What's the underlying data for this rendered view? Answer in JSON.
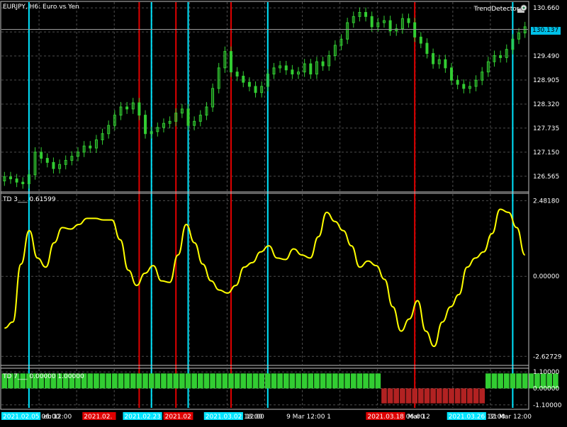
{
  "window": {
    "title": "EURJPY, H6:  Euro vs Yen",
    "indicator_name": "TrendDetector+",
    "current_price": "130.137"
  },
  "colors": {
    "background": "#000000",
    "bull_candle": "#32cd32",
    "signal_up": "#00e5ff",
    "signal_down": "#e00000",
    "osc_line": "#ffff00",
    "hist_up": "#32cd32",
    "hist_down": "#b22222",
    "grid": "#4d4d4d"
  },
  "panes": {
    "td3_label": "TD 3___  0.61599",
    "td7_label": "TD 7___  0.00000 1.00000"
  },
  "chart_data": [
    {
      "type": "candlestick",
      "name": "EURJPY H6",
      "y_ticks": [
        "130.660",
        "130.075",
        "129.490",
        "128.905",
        "128.320",
        "127.735",
        "127.150",
        "126.565"
      ],
      "ylim": [
        126.2,
        130.8
      ],
      "close": [
        126.55,
        126.5,
        126.42,
        126.38,
        126.6,
        127.15,
        127.0,
        126.9,
        126.75,
        126.85,
        126.95,
        127.05,
        127.15,
        127.3,
        127.25,
        127.45,
        127.6,
        127.8,
        128.05,
        128.25,
        128.2,
        128.35,
        128.05,
        127.6,
        127.65,
        127.75,
        127.85,
        127.9,
        128.1,
        128.2,
        127.8,
        127.9,
        128.05,
        128.25,
        128.7,
        129.2,
        129.6,
        129.1,
        129.0,
        128.85,
        128.75,
        128.6,
        128.75,
        129.05,
        129.2,
        129.25,
        129.15,
        129.05,
        129.1,
        129.3,
        129.05,
        129.35,
        129.25,
        129.5,
        129.75,
        129.9,
        130.3,
        130.45,
        130.55,
        130.45,
        130.2,
        130.3,
        130.35,
        130.1,
        130.15,
        130.4,
        130.3,
        129.95,
        129.8,
        129.55,
        129.3,
        129.4,
        129.2,
        128.9,
        128.8,
        128.7,
        128.75,
        128.9,
        129.1,
        129.35,
        129.5,
        129.45,
        129.65,
        129.9,
        130.05,
        130.2
      ]
    },
    {
      "type": "line",
      "name": "TD 3",
      "y_ticks": [
        "2.48180",
        "0.00000",
        "-2.62729"
      ],
      "ylim": [
        -2.9,
        2.7
      ],
      "values": [
        -1.7,
        -1.5,
        0.4,
        1.5,
        0.6,
        0.3,
        1.1,
        1.6,
        1.55,
        1.7,
        1.9,
        1.9,
        1.85,
        1.85,
        1.2,
        0.2,
        -0.3,
        0.1,
        0.35,
        -0.15,
        -0.2,
        0.7,
        1.7,
        1.1,
        0.4,
        -0.15,
        -0.45,
        -0.55,
        -0.3,
        0.3,
        0.45,
        0.8,
        1.0,
        0.6,
        0.55,
        0.9,
        0.7,
        0.6,
        1.3,
        2.1,
        1.8,
        1.5,
        1.0,
        0.3,
        0.5,
        0.35,
        -0.1,
        -1.0,
        -1.8,
        -1.4,
        -0.8,
        -1.8,
        -2.3,
        -1.5,
        -1.0,
        -0.6,
        0.3,
        0.6,
        0.8,
        1.4,
        2.2,
        2.1,
        1.6,
        0.7
      ]
    },
    {
      "type": "bar",
      "name": "TD 7",
      "y_ticks": [
        "1.10000",
        "0.00000",
        "-1.10000"
      ],
      "ylim": [
        -1.3,
        1.3
      ],
      "segments": [
        {
          "from": 0,
          "to": 62,
          "value": 1.0
        },
        {
          "from": 62,
          "to": 79,
          "value": -1.0
        },
        {
          "from": 79,
          "to": 91,
          "value": 1.0
        }
      ]
    }
  ],
  "signals": {
    "up_index": [
      4,
      24,
      30,
      43,
      83
    ],
    "down_index": [
      22,
      28,
      37,
      67
    ]
  },
  "time_axis": {
    "labels": [
      "2021.02.05 06:00",
      "eb 12:00",
      "2021.02.",
      "2021.02.23 0",
      "2021.02",
      "2021.03.02 18:00",
      "12:00",
      "9 Mar 12:00",
      "1",
      "2021.03.18 06:00",
      "Mar 12",
      "2021.03.26 12:00",
      "31 Mar 12:00"
    ],
    "kinds": [
      "cyan",
      "plain",
      "red",
      "cyan",
      "red",
      "cyan",
      "plain",
      "plain",
      "plain",
      "red",
      "plain",
      "cyan",
      "plain"
    ]
  }
}
